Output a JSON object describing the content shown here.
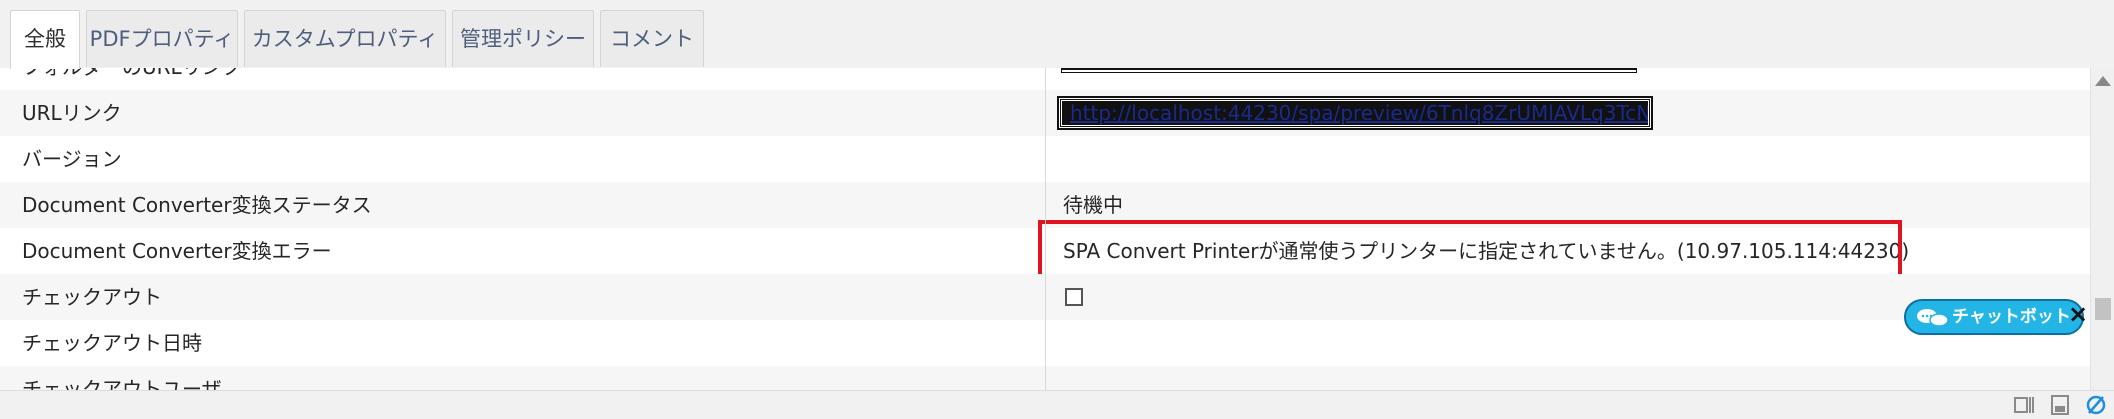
{
  "tabs": [
    {
      "label": "全般",
      "active": true
    },
    {
      "label": "PDFプロパティ",
      "active": false
    },
    {
      "label": "カスタムプロパティ",
      "active": false
    },
    {
      "label": "管理ポリシー",
      "active": false
    },
    {
      "label": "コメント",
      "active": false
    }
  ],
  "properties": {
    "folder_url": {
      "label": "フォルダーのURLリンク",
      "value": ""
    },
    "url_link": {
      "label": "URLリンク",
      "value": "http://localhost:44230/spa/preview/6Tnlq8ZrUMlAVLq3TcNdyg"
    },
    "version": {
      "label": "バージョン",
      "value": ""
    },
    "converter_status": {
      "label": "Document Converter変換ステータス",
      "value": "待機中"
    },
    "converter_error": {
      "label": "Document Converter変換エラー",
      "value": "SPA Convert Printerが通常使うプリンターに指定されていません。(10.97.105.114:44230)"
    },
    "checkout": {
      "label": "チェックアウト",
      "checked": false
    },
    "checkout_datetime": {
      "label": "チェックアウト日時",
      "value": ""
    },
    "checkout_user": {
      "label": "チェックアウトユーザ",
      "value": ""
    }
  },
  "chatbot": {
    "label": "チャットボット",
    "close": "×",
    "color": "#22b5e6"
  },
  "colors": {
    "error_highlight": "#e0141e",
    "link": "#1a2a8a"
  },
  "footer_icons": [
    "column-resize-icon",
    "save-icon",
    "hide-icon"
  ]
}
